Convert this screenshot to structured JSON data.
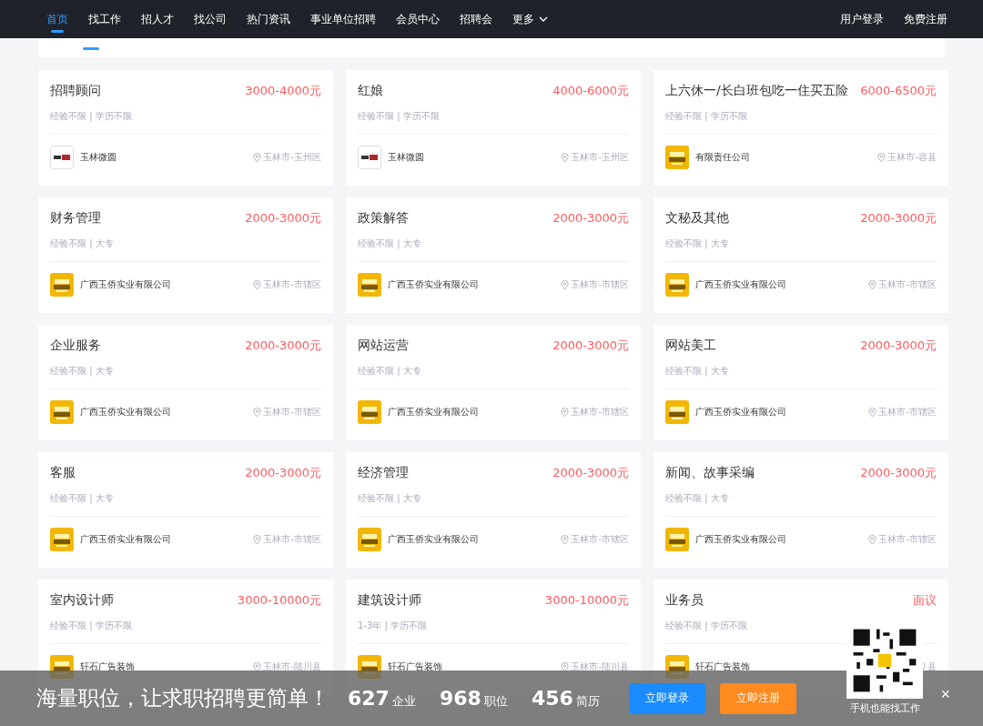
{
  "nav": {
    "items": [
      {
        "label": "首页",
        "selected": true
      },
      {
        "label": "找工作",
        "selected": false
      },
      {
        "label": "招人才",
        "selected": false
      },
      {
        "label": "找公司",
        "selected": false
      },
      {
        "label": "热门资讯",
        "selected": false
      },
      {
        "label": "事业单位招聘",
        "selected": false
      },
      {
        "label": "会员中心",
        "selected": false
      },
      {
        "label": "招聘会",
        "selected": false
      }
    ],
    "more": "更多",
    "login": "用户登录",
    "register": "免费注册"
  },
  "jobs": [
    {
      "title": "招聘顾问",
      "salary": "3000-4000元",
      "requirements": "经验不限 | 学历不限",
      "company": "玉林微圆",
      "kind": "plate",
      "location": "玉林市-玉州区"
    },
    {
      "title": "红娘",
      "salary": "4000-6000元",
      "requirements": "经验不限 | 学历不限",
      "company": "玉林微圆",
      "kind": "plate",
      "location": "玉林市-玉州区"
    },
    {
      "title": "上六休一/长白班包吃一住买五险",
      "salary": "6000-6500元",
      "requirements": "经验不限 | 学历不限",
      "company": "有限责任公司",
      "kind": "badge",
      "location": "玉林市-容县"
    },
    {
      "title": "财务管理",
      "salary": "2000-3000元",
      "requirements": "经验不限 | 大专",
      "company": "广西玉侨实业有限公司",
      "kind": "badge",
      "location": "玉林市-市辖区"
    },
    {
      "title": "政策解答",
      "salary": "2000-3000元",
      "requirements": "经验不限 | 大专",
      "company": "广西玉侨实业有限公司",
      "kind": "badge",
      "location": "玉林市-市辖区"
    },
    {
      "title": "文秘及其他",
      "salary": "2000-3000元",
      "requirements": "经验不限 | 大专",
      "company": "广西玉侨实业有限公司",
      "kind": "badge",
      "location": "玉林市-市辖区"
    },
    {
      "title": "企业服务",
      "salary": "2000-3000元",
      "requirements": "经验不限 | 大专",
      "company": "广西玉侨实业有限公司",
      "kind": "badge",
      "location": "玉林市-市辖区"
    },
    {
      "title": "网站运营",
      "salary": "2000-3000元",
      "requirements": "经验不限 | 大专",
      "company": "广西玉侨实业有限公司",
      "kind": "badge",
      "location": "玉林市-市辖区"
    },
    {
      "title": "网站美工",
      "salary": "2000-3000元",
      "requirements": "经验不限 | 大专",
      "company": "广西玉侨实业有限公司",
      "kind": "badge",
      "location": "玉林市-市辖区"
    },
    {
      "title": "客服",
      "salary": "2000-3000元",
      "requirements": "经验不限 | 大专",
      "company": "广西玉侨实业有限公司",
      "kind": "badge",
      "location": "玉林市-市辖区"
    },
    {
      "title": "经济管理",
      "salary": "2000-3000元",
      "requirements": "经验不限 | 大专",
      "company": "广西玉侨实业有限公司",
      "kind": "badge",
      "location": "玉林市-市辖区"
    },
    {
      "title": "新闻、故事采编",
      "salary": "2000-3000元",
      "requirements": "经验不限 | 大专",
      "company": "广西玉侨实业有限公司",
      "kind": "badge",
      "location": "玉林市-市辖区"
    },
    {
      "title": "室内设计师",
      "salary": "3000-10000元",
      "requirements": "经验不限 | 学历不限",
      "company": "轩石广告装饰",
      "kind": "badge",
      "location": "玉林市-陆川县"
    },
    {
      "title": "建筑设计师",
      "salary": "3000-10000元",
      "requirements": "1-3年 | 学历不限",
      "company": "轩石广告装饰",
      "kind": "badge",
      "location": "玉林市-陆川县"
    },
    {
      "title": "业务员",
      "salary": "面议",
      "requirements": "经验不限 | 学历不限",
      "company": "轩石广告装饰",
      "kind": "badge",
      "location": "县"
    }
  ],
  "banner": {
    "slogan": "海量职位，让求职招聘更简单！",
    "stats": [
      {
        "number": "627",
        "unit": "企业"
      },
      {
        "number": "968",
        "unit": "职位"
      },
      {
        "number": "456",
        "unit": "简历"
      }
    ],
    "login_button": "立即登录",
    "register_button": "立即注册",
    "qr_caption": "手机也能找工作",
    "close": "×"
  }
}
